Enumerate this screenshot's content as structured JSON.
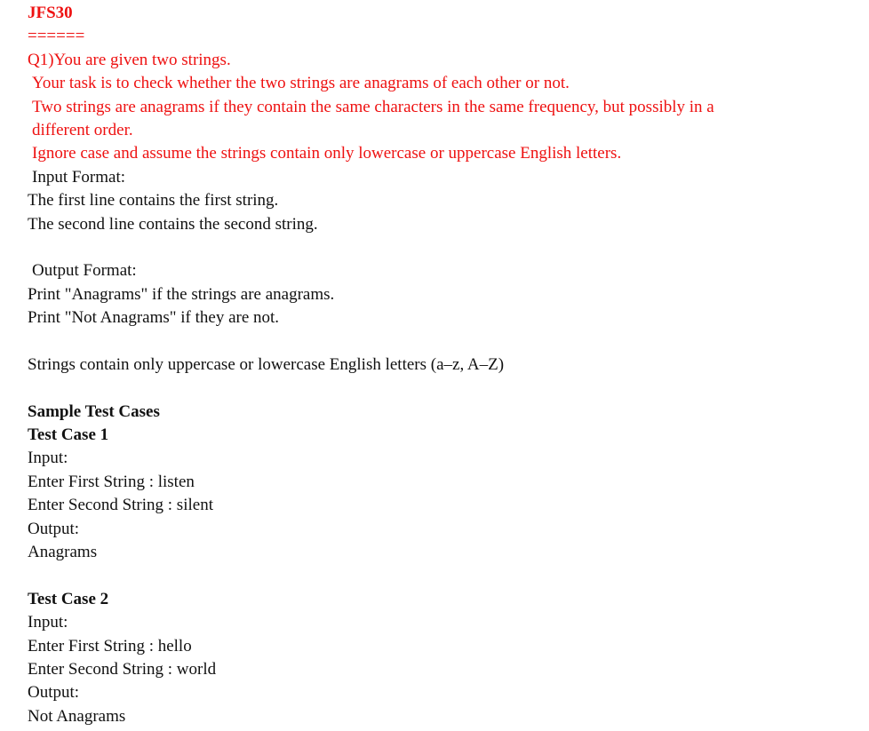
{
  "header": {
    "title": "JFS30",
    "underline": "======"
  },
  "question": {
    "intro": "Q1)You are given two strings.",
    "task": "Your task is to check whether the two strings are anagrams of each other or not.",
    "definition": "Two strings are anagrams if they contain the same characters in the same frequency, but possibly in a different order.",
    "case_note": "Ignore case and assume the strings contain only lowercase or uppercase English letters."
  },
  "input_format": {
    "heading": "Input Format:",
    "line1": "The first line contains the first string.",
    "line2": "The second line contains the second string."
  },
  "output_format": {
    "heading": "Output Format:",
    "line1": "Print \"Anagrams\" if the strings are anagrams.",
    "line2": "Print \"Not Anagrams\" if they are not."
  },
  "constraint": "Strings contain only uppercase or lowercase English letters (a–z, A–Z)",
  "samples": {
    "heading": "Sample Test Cases",
    "cases": [
      {
        "title": "Test Case 1",
        "input_label": "Input:",
        "first": "Enter First String : listen",
        "second": "Enter Second String : silent",
        "output_label": "Output:",
        "output": "Anagrams"
      },
      {
        "title": "Test Case 2",
        "input_label": "Input:",
        "first": "Enter First String : hello",
        "second": "Enter Second String : world",
        "output_label": "Output:",
        "output": "Not Anagrams"
      }
    ]
  },
  "colors": {
    "accent_red": "#ee1111",
    "text": "#111111",
    "background": "#ffffff"
  }
}
